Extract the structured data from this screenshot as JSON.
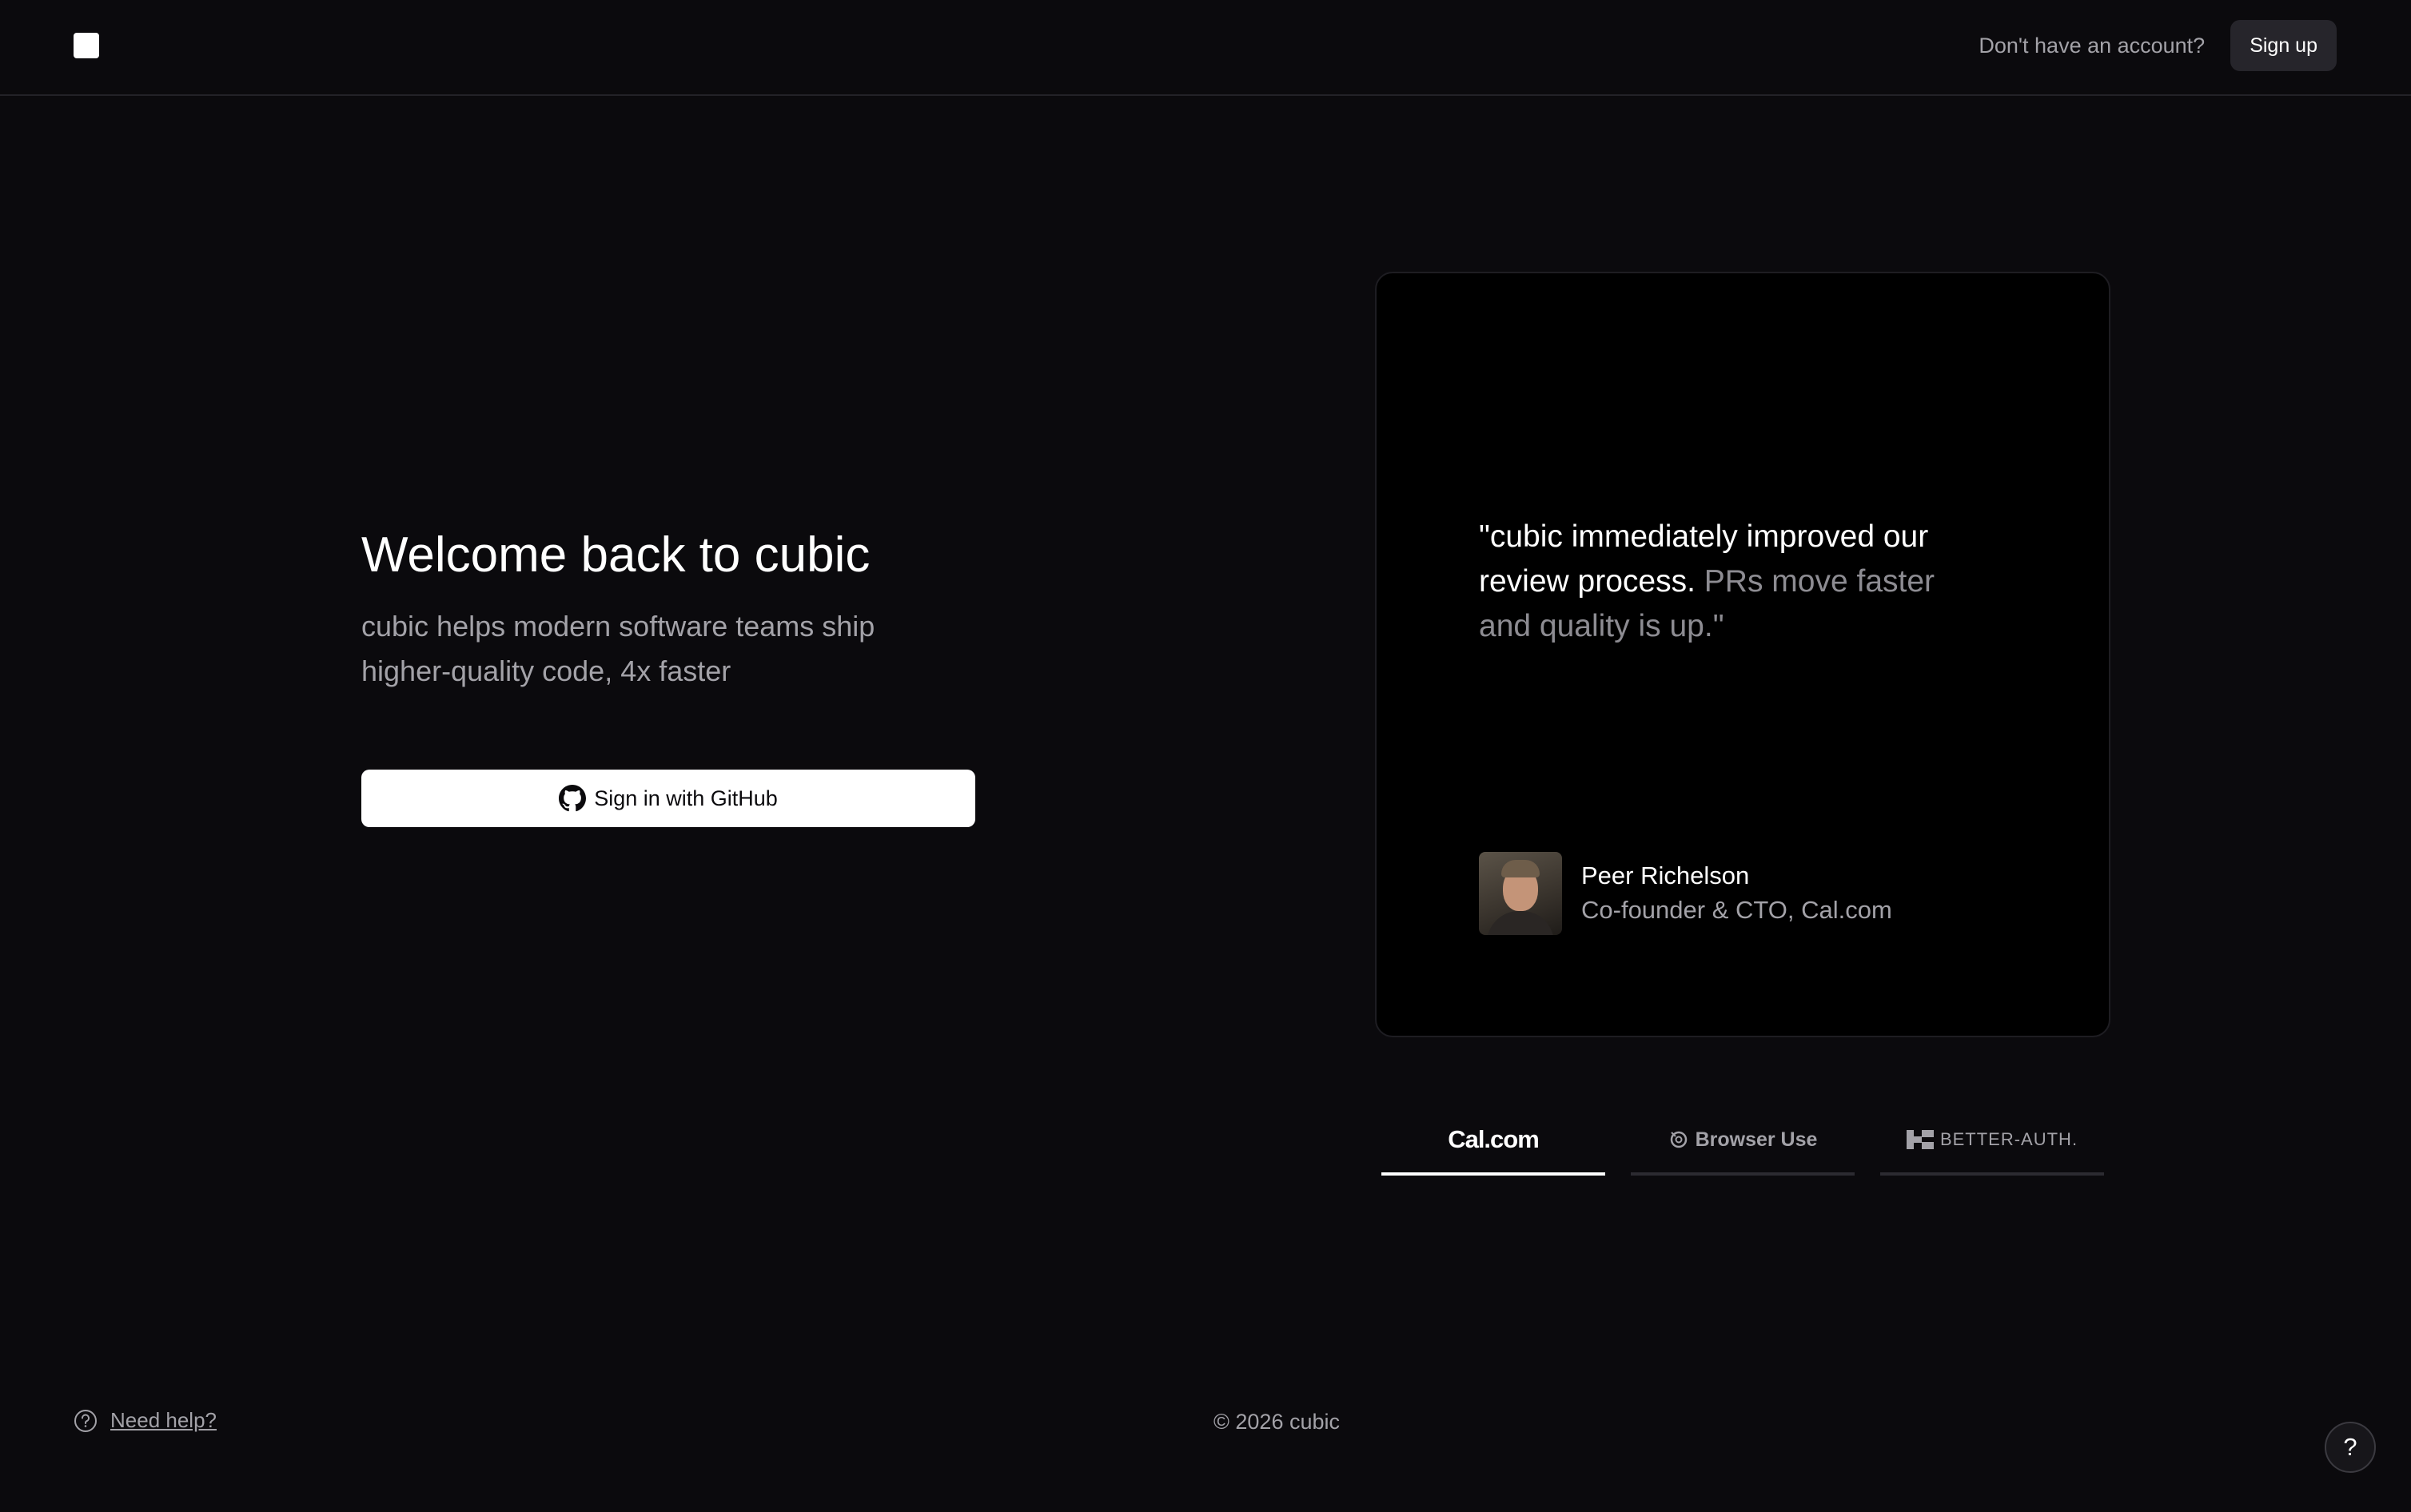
{
  "header": {
    "no_account_text": "Don't have an account?",
    "signup_label": "Sign up"
  },
  "main": {
    "title": "Welcome back to cubic",
    "tagline": "cubic helps modern software teams ship higher-quality code, 4x faster",
    "github_button_label": "Sign in with GitHub"
  },
  "testimonial": {
    "quote_highlight": "\"cubic immediately improved our review process.",
    "quote_rest": " PRs move faster and quality is up.\"",
    "author_name": "Peer Richelson",
    "author_role": "Co-founder & CTO, Cal.com"
  },
  "customer_tabs": [
    {
      "label": "Cal.com",
      "icon": "cal-logo",
      "active": true
    },
    {
      "label": "Browser Use",
      "icon": "browser-use-logo",
      "active": false
    },
    {
      "label": "BETTER-AUTH.",
      "icon": "better-auth-logo",
      "active": false
    }
  ],
  "footer": {
    "help_label": "Need help?",
    "copyright": "© 2026 cubic",
    "help_fab_label": "?"
  },
  "colors": {
    "background": "#0b0a0d",
    "muted_text": "#a3a2a8",
    "card_background": "#000000"
  }
}
